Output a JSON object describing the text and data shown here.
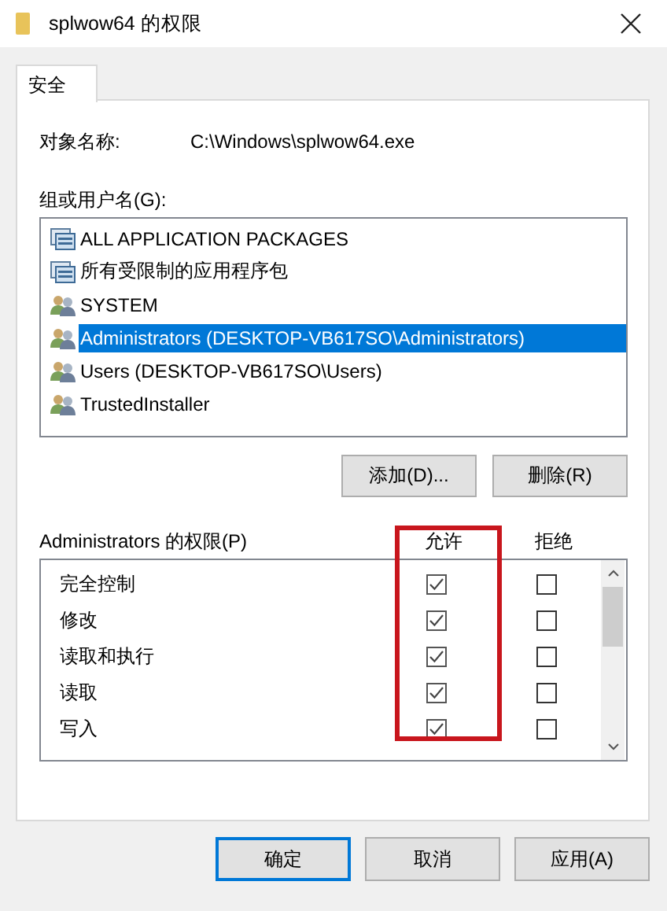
{
  "window": {
    "title": "splwow64 的权限"
  },
  "tabs": [
    {
      "label": "安全",
      "selected": true
    }
  ],
  "object_name": {
    "label": "对象名称:",
    "value": "C:\\Windows\\splwow64.exe"
  },
  "groups": {
    "label": "组或用户名(G):",
    "items": [
      {
        "kind": "package",
        "label": "ALL APPLICATION PACKAGES",
        "selected": false
      },
      {
        "kind": "package",
        "label": "所有受限制的应用程序包",
        "selected": false
      },
      {
        "kind": "group",
        "label": "SYSTEM",
        "selected": false
      },
      {
        "kind": "group",
        "label": "Administrators (DESKTOP-VB617SO\\Administrators)",
        "selected": true
      },
      {
        "kind": "group",
        "label": "Users (DESKTOP-VB617SO\\Users)",
        "selected": false
      },
      {
        "kind": "group",
        "label": "TrustedInstaller",
        "selected": false
      }
    ],
    "buttons": [
      "添加(D)...",
      "删除(R)"
    ]
  },
  "permissions": {
    "label": "Administrators 的权限(P)",
    "allow_header": "允许",
    "deny_header": "拒绝",
    "allow_highlighted": true,
    "rows": [
      {
        "name": "完全控制",
        "allow": true,
        "deny": false
      },
      {
        "name": "修改",
        "allow": true,
        "deny": false
      },
      {
        "name": "读取和执行",
        "allow": true,
        "deny": false
      },
      {
        "name": "读取",
        "allow": true,
        "deny": false
      },
      {
        "name": "写入",
        "allow": true,
        "deny": false
      }
    ]
  },
  "buttons": [
    {
      "label": "确定",
      "default": true
    },
    {
      "label": "取消",
      "default": false
    },
    {
      "label": "应用(A)",
      "default": false
    }
  ]
}
